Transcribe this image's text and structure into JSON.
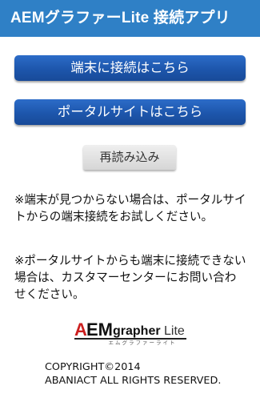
{
  "app": {
    "title": "AEMグラファーLite 接続アプリ"
  },
  "buttons": {
    "connect_device": "端末に接続はこちら",
    "portal_site": "ポータルサイトはこちら",
    "reload": "再読み込み"
  },
  "notes": {
    "note1": "※端末が見つからない場合は、ポータルサイトからの端末接続をお試しください。",
    "note2": "※ポータルサイトからも端末に接続できない場合は、カスタマーセンターにお問い合わせください。"
  },
  "logo": {
    "a": "A",
    "em": "EM",
    "grapher": "grapher",
    "lite": "Lite",
    "kana": "エムグラファーライト",
    "color_red": "#cc1f1f"
  },
  "footer": {
    "copyright_line1": "COPYRIGHT©2014",
    "copyright_line2": "ABANIACT ALL RIGHTS RESERVED."
  },
  "colors": {
    "titlebar": "#2f80c6",
    "primary_button": "#1d56ac",
    "secondary_button": "#d6d6d6"
  }
}
